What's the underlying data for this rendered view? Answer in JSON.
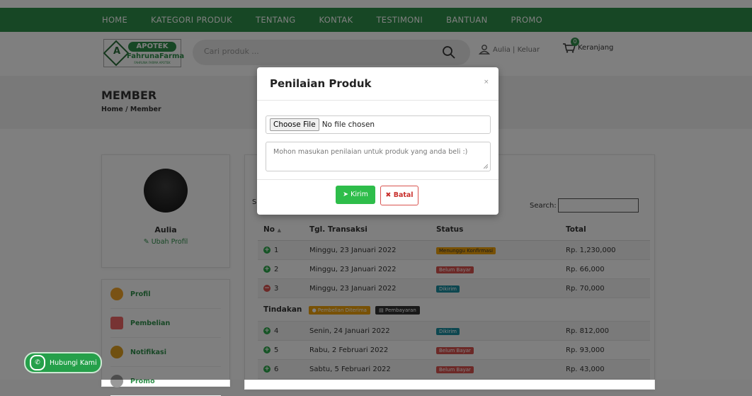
{
  "nav": {
    "items": [
      "HOME",
      "KATEGORI PRODUK",
      "TENTANG",
      "KONTAK",
      "TESTIMONI",
      "BANTUAN",
      "PROMO"
    ]
  },
  "logo": {
    "line1": "APOTEK",
    "line2": "FahrunaFarma",
    "line3": "FAHRUNA FARMA APOTEK"
  },
  "search": {
    "placeholder": "Cari produk ..."
  },
  "user": {
    "link": "Aulia | Keluar"
  },
  "cart": {
    "label": "Keranjang",
    "count": "0"
  },
  "banner": {
    "title": "MEMBER",
    "breadcrumb": "Home / Member"
  },
  "profile": {
    "name": "Aulia",
    "edit": "Ubah Profil"
  },
  "menu": [
    {
      "label": "Profil"
    },
    {
      "label": "Pembelian"
    },
    {
      "label": "Notifikasi"
    },
    {
      "label": "Promo"
    }
  ],
  "table": {
    "search_label": "Search:",
    "show_prefix": "S",
    "headers": [
      "No",
      "Tgl. Transaksi",
      "Status",
      "Total"
    ],
    "rows": [
      {
        "no": "1",
        "date": "Minggu, 23 Januari 2022",
        "status": "Menunggu Konfirmasi",
        "total": "Rp. 1,230,000"
      },
      {
        "no": "2",
        "date": "Minggu, 23 Januari 2022",
        "status": "Belum Bayar",
        "total": "Rp. 66,000"
      },
      {
        "no": "3",
        "date": "Minggu, 23 Januari 2022",
        "status": "Dikirim",
        "total": "Rp. 70,000"
      },
      {
        "no": "4",
        "date": "Senin, 24 Januari 2022",
        "status": "Dikirim",
        "total": "Rp. 812,000"
      },
      {
        "no": "5",
        "date": "Rabu, 2 Februari 2022",
        "status": "Belum Bayar",
        "total": "Rp. 93,000"
      },
      {
        "no": "6",
        "date": "Sabtu, 5 Februari 2022",
        "status": "Belum Bayar",
        "total": "Rp. 43,000"
      }
    ],
    "tindakan": {
      "label": "Tindakan",
      "btn1": "Pembelian Diterima",
      "btn2": "Pembayaran"
    }
  },
  "modal": {
    "title": "Penilaian Produk",
    "close": "×",
    "file_button": "Choose File",
    "file_status": "No file chosen",
    "textarea_placeholder": "Mohon masukan penilaian untuk produk yang anda beli :)",
    "submit": "Kirim",
    "cancel": "Batal"
  },
  "whatsapp": {
    "label": "Hubungi Kami"
  },
  "colors": {
    "brand": "#2f8f4a",
    "waiting": "#f0a30a",
    "unpaid": "#d9534f",
    "shipped": "#1a8fa0"
  }
}
